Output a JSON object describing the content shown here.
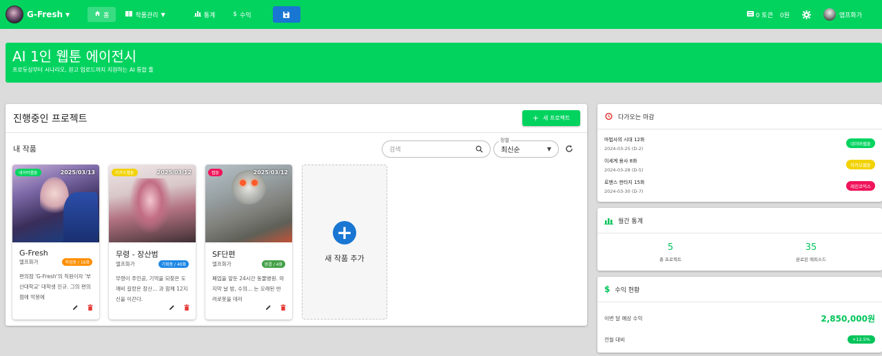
{
  "topbar": {
    "brand": "G-Fresh",
    "nav": {
      "home": "홈",
      "works": "작품관리",
      "stats": "통계",
      "revenue": "수익"
    },
    "tokens": "0 토큰",
    "won": "0원",
    "user": "엡프화가"
  },
  "hero": {
    "title": "AI 1인 웹툰 에이전시",
    "subtitle": "프로듀싱부터 시나리오, 원고 업로드까지 지원하는 AI 통합 툴"
  },
  "projects": {
    "title": "진행중인 프로젝트",
    "new_button": "새 프로젝트",
    "section": "내 작품",
    "search_placeholder": "검색",
    "sort_label": "정렬",
    "sort_value": "최신순",
    "works": [
      {
        "platform": "네이버웹툰",
        "platform_color": "#02d35f",
        "date": "2025/03/13",
        "title": "G-Fresh",
        "author": "엘프화가",
        "status": "작업중 / 16화",
        "status_color": "#ff8f00",
        "desc": "편의점 'G-Fresh'의 직원이자 '부산대학교' 대학생 진규. 그의 편의점에 악몽에"
      },
      {
        "platform": "카카오웹툰",
        "platform_color": "#f2d200",
        "date": "2025/03/12",
        "title": "무령 - 장산범",
        "author": "엘프화가",
        "status": "기획중 / 40화",
        "status_color": "#1e88e5",
        "desc": "무령이 주인공, 기억을 되찾은 도깨비 길랑은 장산... 과 함께 12지신을 이끈다."
      },
      {
        "platform": "짭툰",
        "platform_color": "#f0145a",
        "date": "2025/03/12",
        "title": "SF단편",
        "author": "엘프화가",
        "status": "완결 / 4화",
        "status_color": "#43a047",
        "desc": "폐업을 앞둔 24시간 동물병원. 마지막 날 밤, 수의... 는 오래된 반려로봇을 데리"
      }
    ],
    "add_label": "새 작품 추가"
  },
  "deadlines": {
    "title": "다가오는 마감",
    "items": [
      {
        "name": "마법사의 시대 12화",
        "date": "2024-03-25 (D-2)",
        "platform": "네이버웹툰",
        "color": "#02d35f"
      },
      {
        "name": "이세계 용사 8화",
        "date": "2024-03-28 (D-5)",
        "platform": "카카오웹툰",
        "color": "#f2d200"
      },
      {
        "name": "로맨스 판타지 15화",
        "date": "2024-03-30 (D-7)",
        "platform": "레진코믹스",
        "color": "#f0145a"
      }
    ]
  },
  "monthly": {
    "title": "월간 통계",
    "projects_value": "5",
    "projects_label": "총 프로젝트",
    "episodes_value": "35",
    "episodes_label": "완료된 에피소드"
  },
  "revenue": {
    "title": "수익 현황",
    "expected_label": "이번 달 예상 수익",
    "expected_value": "2,850,000원",
    "compare_label": "전월 대비",
    "compare_value": "+12.5%"
  }
}
